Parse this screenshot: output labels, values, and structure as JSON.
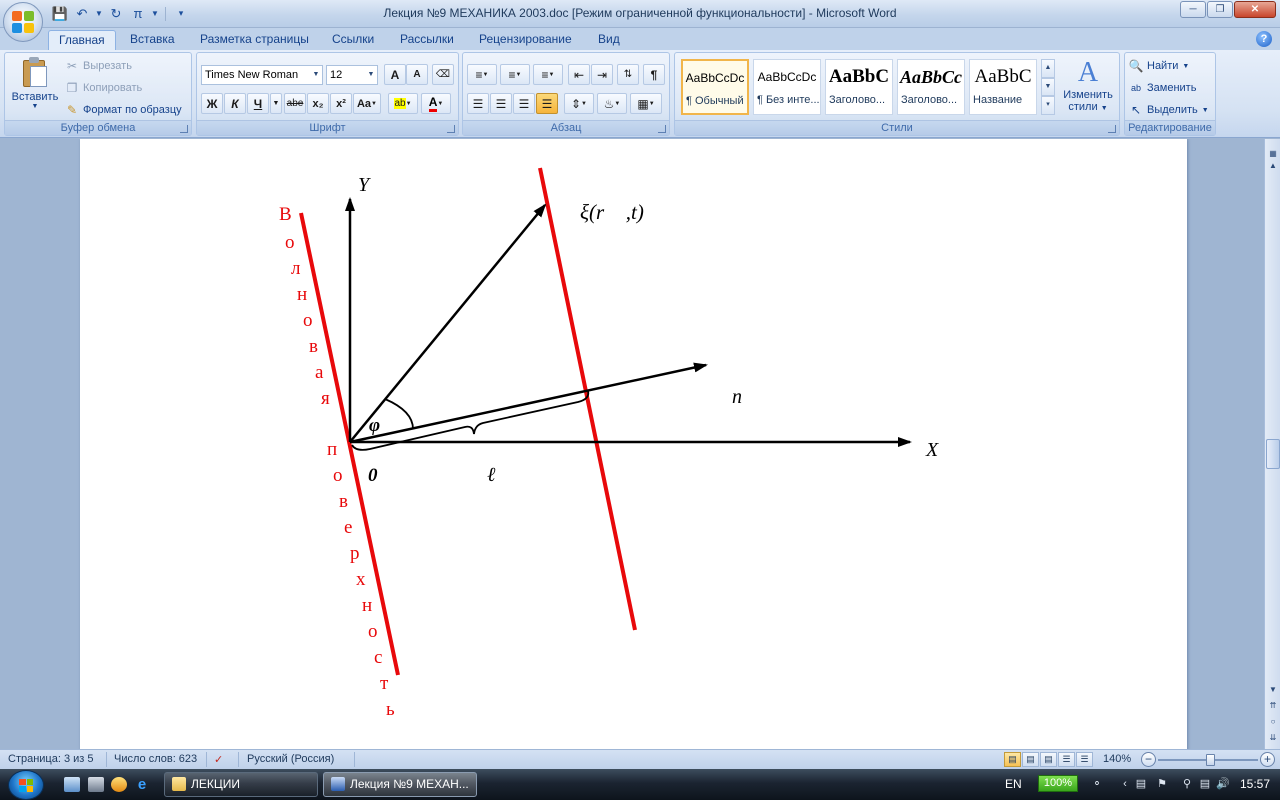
{
  "window": {
    "title": "Лекция №9 МЕХАНИКА 2003.doc [Режим ограниченной функциональности] - Microsoft Word",
    "qat": {
      "pi_symbol": "π"
    }
  },
  "tabs": [
    "Главная",
    "Вставка",
    "Разметка страницы",
    "Ссылки",
    "Рассылки",
    "Рецензирование",
    "Вид"
  ],
  "ribbon": {
    "clipboard": {
      "paste": "Вставить",
      "cut": "Вырезать",
      "copy": "Копировать",
      "format_painter": "Формат по образцу",
      "label": "Буфер обмена"
    },
    "font": {
      "name": "Times New Roman",
      "size": "12",
      "label": "Шрифт",
      "grow": "A",
      "shrink": "A",
      "bold": "Ж",
      "italic": "К",
      "underline": "Ч",
      "strike": "abe",
      "subscript": "x₂",
      "superscript": "x²",
      "case": "Aa",
      "highlight": "ab",
      "color": "A"
    },
    "paragraph": {
      "label": "Абзац",
      "pilcrow": "¶"
    },
    "styles": {
      "label": "Стили",
      "items": [
        {
          "sample": "AaBbCcDc",
          "name": "¶ Обычный"
        },
        {
          "sample": "AaBbCcDc",
          "name": "¶ Без инте..."
        },
        {
          "sample": "AaBbC",
          "name": "Заголово..."
        },
        {
          "sample": "AaBbCc",
          "name": "Заголово..."
        },
        {
          "sample": "AaBbC",
          "name": "Название"
        }
      ],
      "change_line1": "Изменить",
      "change_line2": "стили"
    },
    "editing": {
      "label": "Редактирование",
      "find": "Найти",
      "replace": "Заменить",
      "select": "Выделить"
    }
  },
  "document": {
    "axis_y": "Y",
    "axis_x": "X",
    "xi_label": "ξ(r⃗ ,t)",
    "n_label": "n⃗",
    "phi_label": "φ",
    "origin_label": "0",
    "l_label": "ℓ",
    "wave_surface_letters": [
      "В",
      "о",
      "л",
      "н",
      "о",
      "в",
      "а",
      "я",
      "п",
      "о",
      "в",
      "е",
      "р",
      "х",
      "н",
      "о",
      "с",
      "т",
      "ь"
    ],
    "colors": {
      "wave": "#e8090b",
      "axis": "#000000"
    }
  },
  "status": {
    "page": "Страница: 3 из 5",
    "words": "Число слов: 623",
    "language": "Русский (Россия)",
    "zoom": "140%"
  },
  "taskbar": {
    "btn_folder": "ЛЕКЦИИ",
    "btn_word": "Лекция №9 МЕХАН...",
    "lang": "EN",
    "battery": "100%",
    "time": "15:57"
  }
}
